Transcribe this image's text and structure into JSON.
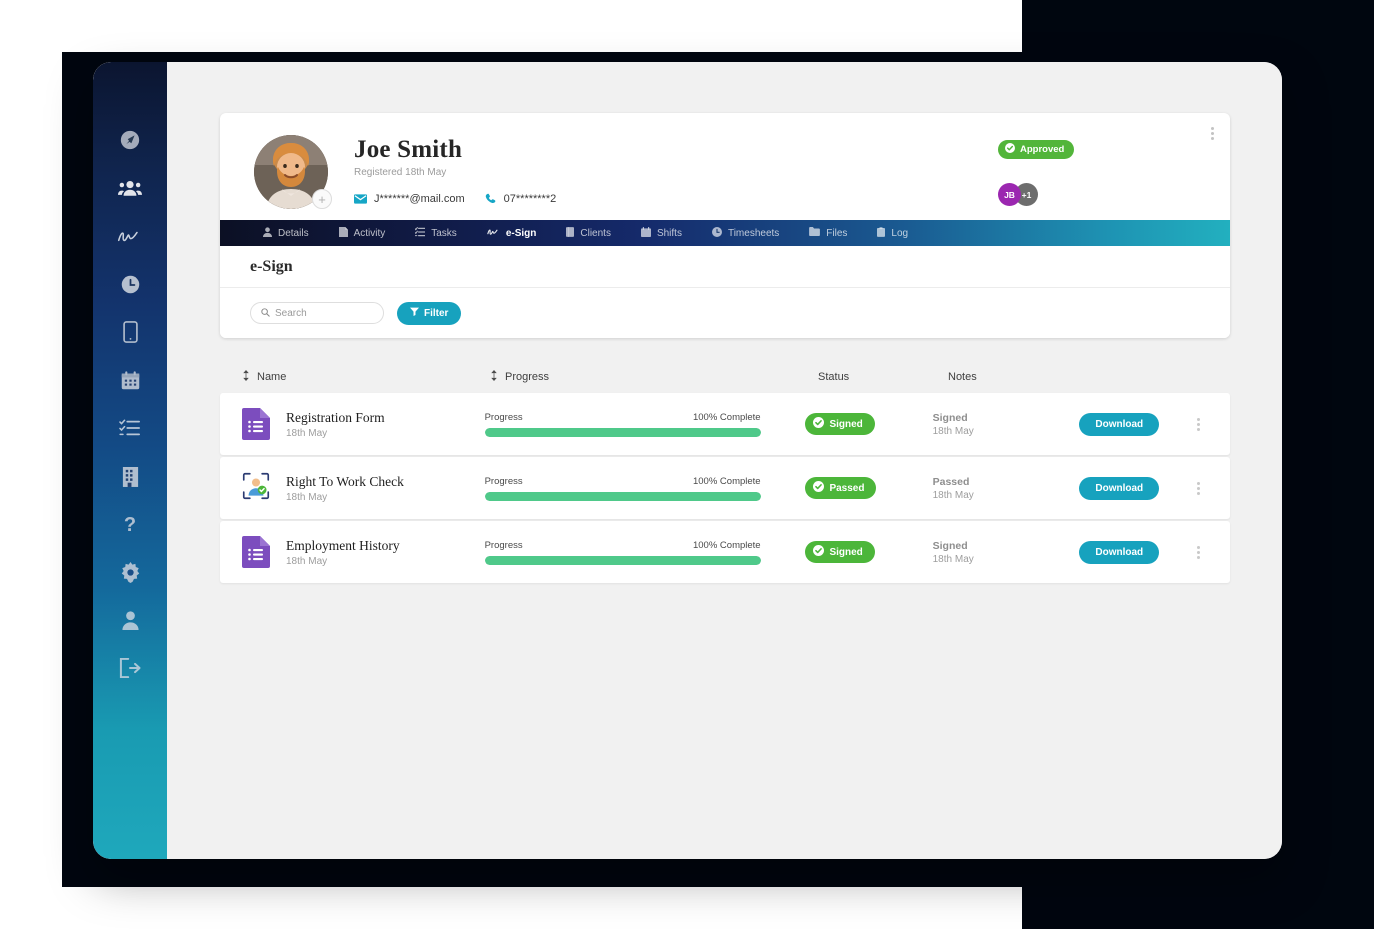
{
  "sidebar": {
    "items": [
      {
        "name": "dashboard",
        "icon": "rocket-icon"
      },
      {
        "name": "people",
        "icon": "users-icon"
      },
      {
        "name": "esign",
        "icon": "signature-icon"
      },
      {
        "name": "time",
        "icon": "clock-icon"
      },
      {
        "name": "mobile",
        "icon": "mobile-icon"
      },
      {
        "name": "calendar",
        "icon": "calendar-icon"
      },
      {
        "name": "tasks",
        "icon": "tasklist-icon"
      },
      {
        "name": "companies",
        "icon": "building-icon"
      },
      {
        "name": "help",
        "icon": "question-icon"
      },
      {
        "name": "settings",
        "icon": "gear-icon"
      },
      {
        "name": "account",
        "icon": "user-icon"
      },
      {
        "name": "logout",
        "icon": "logout-icon"
      }
    ]
  },
  "profile": {
    "name": "Joe Smith",
    "registered": "Registered 18th May",
    "email": "J*******@mail.com",
    "phone": "07********2",
    "badge": "Approved",
    "badge_color": "#52b53a",
    "avatar_add": "+",
    "collaborators": [
      {
        "initials": "JB",
        "color": "#9b27b0"
      },
      {
        "initials": "+1",
        "color": "#6d6d6d"
      }
    ]
  },
  "tabs": [
    {
      "label": "Details",
      "icon": "person-icon",
      "active": false
    },
    {
      "label": "Activity",
      "icon": "note-icon",
      "active": false
    },
    {
      "label": "Tasks",
      "icon": "list-icon",
      "active": false
    },
    {
      "label": "e-Sign",
      "icon": "signature-icon",
      "active": true
    },
    {
      "label": "Clients",
      "icon": "book-icon",
      "active": false
    },
    {
      "label": "Shifts",
      "icon": "calendar-icon",
      "active": false
    },
    {
      "label": "Timesheets",
      "icon": "clock-icon",
      "active": false
    },
    {
      "label": "Files",
      "icon": "folder-icon",
      "active": false
    },
    {
      "label": "Log",
      "icon": "clipboard-icon",
      "active": false
    }
  ],
  "section": {
    "title": "e-Sign"
  },
  "toolbar": {
    "search_value": "",
    "search_placeholder": "Search",
    "search_icon": "search-icon",
    "filter_label": "Filter",
    "filter_icon": "funnel-icon",
    "accent_color": "#17a2be"
  },
  "table": {
    "columns": [
      {
        "label": "Name",
        "sortable": true
      },
      {
        "label": "Progress",
        "sortable": true
      },
      {
        "label": "Status",
        "sortable": false
      },
      {
        "label": "Notes",
        "sortable": false
      },
      {
        "label": "",
        "sortable": false
      }
    ],
    "rows": [
      {
        "doc_icon": "form-doc-icon",
        "name": "Registration Form",
        "date": "18th May",
        "progress_label": "Progress",
        "progress_text": "100% Complete",
        "progress_value": 100,
        "status": "Signed",
        "status_color": "#4cb63a",
        "notes_title": "Signed",
        "notes_date": "18th May",
        "action_label": "Download"
      },
      {
        "doc_icon": "id-check-icon",
        "name": "Right To Work Check",
        "date": "18th May",
        "progress_label": "Progress",
        "progress_text": "100% Complete",
        "progress_value": 100,
        "status": "Passed",
        "status_color": "#4cb63a",
        "notes_title": "Passed",
        "notes_date": "18th May",
        "action_label": "Download"
      },
      {
        "doc_icon": "form-doc-icon",
        "name": "Employment History",
        "date": "18th May",
        "progress_label": "Progress",
        "progress_text": "100% Complete",
        "progress_value": 100,
        "status": "Signed",
        "status_color": "#4cb63a",
        "notes_title": "Signed",
        "notes_date": "18th May",
        "action_label": "Download"
      }
    ]
  }
}
